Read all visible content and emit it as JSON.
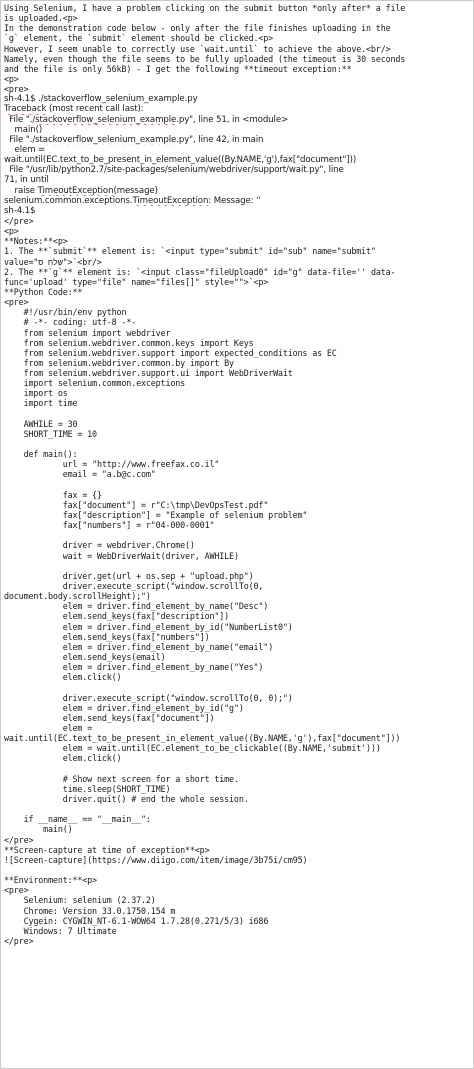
{
  "document": {
    "lines": [
      {
        "f": "m",
        "s": [
          {
            "t": "Using Selenium, I have a problem clicking on the submit button *only after* a file"
          }
        ]
      },
      {
        "f": "m",
        "s": [
          {
            "t": "is uploaded.<p>"
          }
        ]
      },
      {
        "f": "m",
        "s": [
          {
            "t": "In the demonstration code below - only after the file finishes uploading in the"
          }
        ]
      },
      {
        "f": "m",
        "s": [
          {
            "t": "`g` element, the `submit` element should be clicked.<p>"
          }
        ]
      },
      {
        "f": "m",
        "s": [
          {
            "t": "However, I seem unable to correctly use `wait.until` to achieve the above.<br/>"
          }
        ]
      },
      {
        "f": "m",
        "s": [
          {
            "t": "Namely, even though the file seems to be fully uploaded (the "
          },
          {
            "t": "timeout",
            "u": 1
          },
          {
            "t": " is 30 seconds"
          }
        ]
      },
      {
        "f": "m",
        "s": [
          {
            "t": "and the file is only "
          },
          {
            "t": "56kB",
            "u": 1
          },
          {
            "t": ") - I get the following **"
          },
          {
            "t": "timeout",
            "u": 1
          },
          {
            "t": " exception:**"
          }
        ]
      },
      {
        "f": "m",
        "s": [
          {
            "t": "<p>"
          }
        ]
      },
      {
        "f": "m",
        "s": [
          {
            "t": "<pre>"
          }
        ]
      },
      {
        "f": "s",
        "s": [
          {
            "t": "sh-4.1$ ./"
          },
          {
            "t": "stackoverflow_selenium_example.py",
            "u": 1
          }
        ]
      },
      {
        "f": "s",
        "s": [
          {
            "t": "Traceback",
            "u": 1
          },
          {
            "t": " (most recent call last):"
          }
        ]
      },
      {
        "f": "s",
        "s": [
          {
            "t": "  File \"./"
          },
          {
            "t": "stackoverflow_selenium_example",
            "u": 1
          },
          {
            "t": ".py\", line 51, in <module>"
          }
        ]
      },
      {
        "f": "s",
        "s": [
          {
            "t": "    main()"
          }
        ]
      },
      {
        "f": "s",
        "s": [
          {
            "t": "  File \"./"
          },
          {
            "t": "stackoverflow_selenium_example",
            "u": 1
          },
          {
            "t": ".py\", line 42, in main"
          }
        ]
      },
      {
        "f": "s",
        "s": [
          {
            "t": "    "
          },
          {
            "t": "elem",
            "u": 1
          },
          {
            "t": " ="
          }
        ]
      },
      {
        "f": "s",
        "s": [
          {
            "t": "wait.until(EC.text_to_be_present_in_element_value((By.NAME,'g'),fax[\"document\"]))"
          }
        ]
      },
      {
        "f": "s",
        "s": [
          {
            "t": "  File \"/"
          },
          {
            "t": "usr",
            "u": 1
          },
          {
            "t": "/lib/python2.7/site-packages/selenium/"
          },
          {
            "t": "webdriver",
            "u": 1
          },
          {
            "t": "/support/"
          },
          {
            "t": "wait.py",
            "u": 1
          },
          {
            "t": "\", line"
          }
        ]
      },
      {
        "f": "s",
        "s": [
          {
            "t": "71, in until"
          }
        ]
      },
      {
        "f": "s",
        "s": [
          {
            "t": "    raise "
          },
          {
            "t": "TimeoutException",
            "u": 1
          },
          {
            "t": "(message)"
          }
        ]
      },
      {
        "f": "s",
        "s": [
          {
            "t": "selenium.common.exceptions."
          },
          {
            "t": "TimeoutException",
            "u": 1
          },
          {
            "t": ": Message: ''"
          }
        ]
      },
      {
        "f": "s",
        "s": [
          {
            "t": "sh-4.1$"
          }
        ]
      },
      {
        "f": "m",
        "s": [
          {
            "t": "</pre>"
          }
        ]
      },
      {
        "f": "m",
        "s": [
          {
            "t": "<p>"
          }
        ]
      },
      {
        "f": "m",
        "s": [
          {
            "t": "**Notes:**<p>"
          }
        ]
      },
      {
        "f": "m",
        "s": [
          {
            "t": "1. The **`submit`** element is: `<input type=\"submit\" id=\"sub\" name=\"submit\""
          }
        ]
      },
      {
        "f": "m",
        "s": [
          {
            "t": "value=\""
          },
          {
            "t": "שלח ס",
            "u": 1
          },
          {
            "t": "\">`<br/>"
          }
        ]
      },
      {
        "f": "m",
        "s": [
          {
            "t": "2. The **`g`** element is: `<input class=\""
          },
          {
            "t": "fileUpload0",
            "u": 1
          },
          {
            "t": "\" id=\"g\" data-file='' data-"
          }
        ]
      },
      {
        "f": "m",
        "s": [
          {
            "t": "func='upload' type=\"file\" name=\"files[]\" style=\"\">`<p>"
          }
        ]
      },
      {
        "f": "m",
        "s": [
          {
            "t": "**Python Code:**"
          }
        ]
      },
      {
        "f": "m",
        "s": [
          {
            "t": "<pre>"
          }
        ]
      },
      {
        "f": "m",
        "s": [
          {
            "t": "    #!/"
          },
          {
            "t": "usr",
            "u": 1
          },
          {
            "t": "/bin/"
          },
          {
            "t": "env",
            "u": 1
          },
          {
            "t": " python"
          }
        ]
      },
      {
        "f": "m",
        "s": [
          {
            "t": "    # -*- coding: "
          },
          {
            "t": "utf",
            "u": 1
          },
          {
            "t": "-8 -*-"
          }
        ]
      },
      {
        "f": "m",
        "s": [
          {
            "t": "    from selenium import "
          },
          {
            "t": "webdriver",
            "u": 1
          }
        ]
      },
      {
        "f": "m",
        "s": [
          {
            "t": "    from "
          },
          {
            "t": "selenium.webdriver.common.keys",
            "u": 1
          },
          {
            "t": " import Keys"
          }
        ]
      },
      {
        "f": "m",
        "s": [
          {
            "t": "    from "
          },
          {
            "t": "selenium.webdriver.support",
            "u": 1
          },
          {
            "t": " import expected_conditions as EC"
          }
        ]
      },
      {
        "f": "m",
        "s": [
          {
            "t": "    from "
          },
          {
            "t": "selenium.webdriver.common.by",
            "u": 1
          },
          {
            "t": " import By"
          }
        ]
      },
      {
        "f": "m",
        "s": [
          {
            "t": "    from "
          },
          {
            "t": "selenium.webdriver.support.ui",
            "u": 1
          },
          {
            "t": " import "
          },
          {
            "t": "WebDriverWait",
            "u": 1
          }
        ]
      },
      {
        "f": "m",
        "s": [
          {
            "t": "    import selenium.common.exceptions"
          }
        ]
      },
      {
        "f": "m",
        "s": [
          {
            "t": "    import "
          },
          {
            "t": "os",
            "u": 1
          }
        ]
      },
      {
        "f": "m",
        "s": [
          {
            "t": "    import time"
          }
        ]
      },
      {
        "f": "m",
        "s": [
          {
            "t": ""
          }
        ]
      },
      {
        "f": "m",
        "s": [
          {
            "t": "    AWHILE = 30"
          }
        ]
      },
      {
        "f": "m",
        "s": [
          {
            "t": "    SHORT_TIME = 10"
          }
        ]
      },
      {
        "f": "m",
        "s": [
          {
            "t": ""
          }
        ]
      },
      {
        "f": "m",
        "s": [
          {
            "t": "    "
          },
          {
            "t": "def",
            "u": 1
          },
          {
            "t": " main():"
          }
        ]
      },
      {
        "f": "m",
        "s": [
          {
            "t": "            "
          },
          {
            "t": "url",
            "u": 1
          },
          {
            "t": " = \"http://www.freefax.co.il\""
          }
        ]
      },
      {
        "f": "m",
        "s": [
          {
            "t": "            email = \"a.b@"
          },
          {
            "t": "c.com",
            "u": 1
          },
          {
            "t": "\""
          }
        ]
      },
      {
        "f": "m",
        "s": [
          {
            "t": ""
          }
        ]
      },
      {
        "f": "m",
        "s": [
          {
            "t": "            fax = {}"
          }
        ]
      },
      {
        "f": "m",
        "s": [
          {
            "t": "            fax[\"document\"] = r\"C:\\"
          },
          {
            "t": "tmp",
            "u": 1
          },
          {
            "t": "\\"
          },
          {
            "t": "DevOpsTest.pdf",
            "u": 1
          },
          {
            "t": "\""
          }
        ]
      },
      {
        "f": "m",
        "s": [
          {
            "t": "            fax[\"description\"] = \"Example of selenium problem\""
          }
        ]
      },
      {
        "f": "m",
        "s": [
          {
            "t": "            fax[\"numbers\"] = r\"04-000-0001\""
          }
        ]
      },
      {
        "f": "m",
        "s": [
          {
            "t": ""
          }
        ]
      },
      {
        "f": "m",
        "s": [
          {
            "t": "            driver = "
          },
          {
            "t": "webdriver.Chrome",
            "u": 1
          },
          {
            "t": "()"
          }
        ]
      },
      {
        "f": "m",
        "s": [
          {
            "t": "            wait = "
          },
          {
            "t": "WebDriverWait",
            "u": 1
          },
          {
            "t": "(driver, AWHILE)"
          }
        ]
      },
      {
        "f": "m",
        "s": [
          {
            "t": ""
          }
        ]
      },
      {
        "f": "m",
        "s": [
          {
            "t": "            driver.get("
          },
          {
            "t": "url",
            "u": 1
          },
          {
            "t": " + "
          },
          {
            "t": "os.sep",
            "u": 1
          },
          {
            "t": " + \""
          },
          {
            "t": "upload.php",
            "u": 1
          },
          {
            "t": "\")"
          }
        ]
      },
      {
        "f": "m",
        "s": [
          {
            "t": "            driver.execute_script(\""
          },
          {
            "t": "window.scrollTo",
            "u": 1
          },
          {
            "t": "(0,"
          }
        ]
      },
      {
        "f": "m",
        "s": [
          {
            "t": "document.body.scrollHeight",
            "u": 1
          },
          {
            "t": ");\")"
          }
        ]
      },
      {
        "f": "m",
        "s": [
          {
            "t": "            "
          },
          {
            "t": "elem",
            "u": 1
          },
          {
            "t": " = driver.find_element_by_name(\"Desc\")"
          }
        ]
      },
      {
        "f": "m",
        "s": [
          {
            "t": "            "
          },
          {
            "t": "elem.send_keys",
            "u": 1
          },
          {
            "t": "(fax[\"description\"])"
          }
        ]
      },
      {
        "f": "m",
        "s": [
          {
            "t": "            "
          },
          {
            "t": "elem",
            "u": 1
          },
          {
            "t": " = driver.find_element_by_id(\""
          },
          {
            "t": "NumberList0",
            "u": 1
          },
          {
            "t": "\")"
          }
        ]
      },
      {
        "f": "m",
        "s": [
          {
            "t": "            "
          },
          {
            "t": "elem.send_keys",
            "u": 1
          },
          {
            "t": "(fax[\"numbers\"])"
          }
        ]
      },
      {
        "f": "m",
        "s": [
          {
            "t": "            "
          },
          {
            "t": "elem",
            "u": 1
          },
          {
            "t": " = driver.find_element_by_name(\"email\")"
          }
        ]
      },
      {
        "f": "m",
        "s": [
          {
            "t": "            "
          },
          {
            "t": "elem.send_keys",
            "u": 1
          },
          {
            "t": "(email)"
          }
        ]
      },
      {
        "f": "m",
        "s": [
          {
            "t": "            "
          },
          {
            "t": "elem",
            "u": 1
          },
          {
            "t": " = driver.find_element_by_name(\"Yes\")"
          }
        ]
      },
      {
        "f": "m",
        "s": [
          {
            "t": "            "
          },
          {
            "t": "elem.click",
            "u": 1
          },
          {
            "t": "()"
          }
        ]
      },
      {
        "f": "m",
        "s": [
          {
            "t": ""
          }
        ]
      },
      {
        "f": "m",
        "s": [
          {
            "t": "            driver.execute_script(\""
          },
          {
            "t": "window.scrollTo",
            "u": 1
          },
          {
            "t": "(0, 0);\")"
          }
        ]
      },
      {
        "f": "m",
        "s": [
          {
            "t": "            "
          },
          {
            "t": "elem",
            "u": 1
          },
          {
            "t": " = driver.find_element_by_id(\"g\")"
          }
        ]
      },
      {
        "f": "m",
        "s": [
          {
            "t": "            "
          },
          {
            "t": "elem.send_keys",
            "u": 1
          },
          {
            "t": "(fax[\"document\"])"
          }
        ]
      },
      {
        "f": "m",
        "s": [
          {
            "t": "            "
          },
          {
            "t": "elem",
            "u": 1
          },
          {
            "t": " ="
          }
        ]
      },
      {
        "f": "m",
        "s": [
          {
            "t": "wait.until(EC.text_to_be_present_in_element_value((By.NAME,'g'),fax[\"document\"]))"
          }
        ]
      },
      {
        "f": "m",
        "s": [
          {
            "t": "            "
          },
          {
            "t": "elem",
            "u": 1
          },
          {
            "t": " = wait.until(EC."
          },
          {
            "t": "element_to_be_clickable",
            "u": 1
          },
          {
            "t": "((By.NAME,'submit')))"
          }
        ]
      },
      {
        "f": "m",
        "s": [
          {
            "t": "            "
          },
          {
            "t": "elem.click",
            "u": 1
          },
          {
            "t": "()"
          }
        ]
      },
      {
        "f": "m",
        "s": [
          {
            "t": ""
          }
        ]
      },
      {
        "f": "m",
        "s": [
          {
            "t": "            # Show next screen for a short time."
          }
        ]
      },
      {
        "f": "m",
        "s": [
          {
            "t": "            time.sleep(SHORT_TIME)"
          }
        ]
      },
      {
        "f": "m",
        "s": [
          {
            "t": "            driver.quit() # end the whole session."
          }
        ]
      },
      {
        "f": "m",
        "s": [
          {
            "t": ""
          }
        ]
      },
      {
        "f": "m",
        "s": [
          {
            "t": "    if __name__ == \"__main__\":"
          }
        ]
      },
      {
        "f": "m",
        "s": [
          {
            "t": "        main()"
          }
        ]
      },
      {
        "f": "m",
        "s": [
          {
            "t": "</"
          },
          {
            "t": "pre",
            "u": 1
          },
          {
            "t": ">"
          }
        ]
      },
      {
        "f": "m",
        "s": [
          {
            "t": "**Screen-capture at time of exception**<p>"
          }
        ]
      },
      {
        "f": "m",
        "s": [
          {
            "t": "![Screen-capture]("
          },
          {
            "t": "https",
            "u": 1
          },
          {
            "t": "://"
          },
          {
            "t": "www.diigo.com",
            "u": 1
          },
          {
            "t": "/item/image/"
          },
          {
            "t": "3b75i",
            "u": 1
          },
          {
            "t": "/"
          },
          {
            "t": "cm95",
            "u": 1
          },
          {
            "t": ")"
          }
        ]
      },
      {
        "f": "m",
        "s": [
          {
            "t": ""
          }
        ]
      },
      {
        "f": "m",
        "s": [
          {
            "t": "**Environment:**<p>"
          }
        ]
      },
      {
        "f": "m",
        "s": [
          {
            "t": "<pre>"
          }
        ]
      },
      {
        "f": "m",
        "s": [
          {
            "t": "    Selenium: selenium (2.37.2)"
          }
        ]
      },
      {
        "f": "m",
        "s": [
          {
            "t": "    Chrome: Version 33.0.1750.154 m"
          }
        ]
      },
      {
        "f": "m",
        "s": [
          {
            "t": "    "
          },
          {
            "t": "Cygein",
            "u": 1
          },
          {
            "t": ": "
          },
          {
            "t": "CYGWIN_NT-6.1-WOW64",
            "u": 1
          },
          {
            "t": " 1.7.28(0.271/5/3) "
          },
          {
            "t": "i686",
            "u": 1
          }
        ]
      },
      {
        "f": "m",
        "s": [
          {
            "t": "    Windows: 7 Ultimate"
          }
        ]
      },
      {
        "f": "m",
        "s": [
          {
            "t": "</pre>"
          }
        ]
      }
    ]
  }
}
